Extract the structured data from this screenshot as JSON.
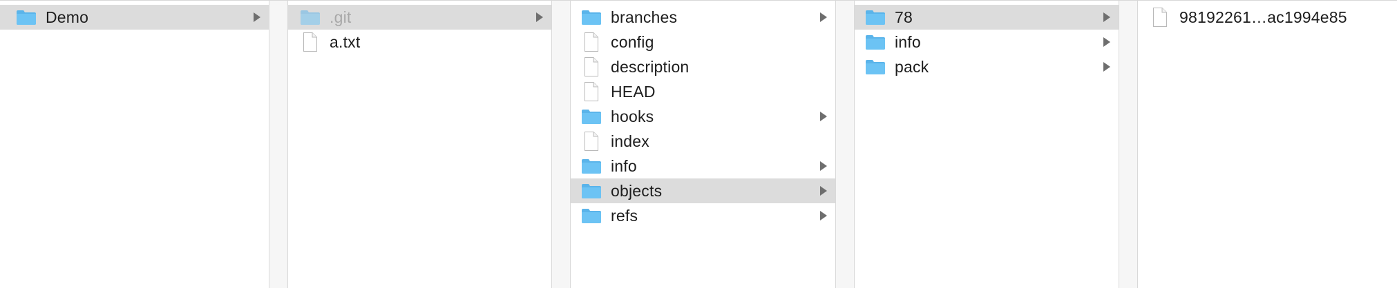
{
  "columns": [
    {
      "items": [
        {
          "label": "Demo",
          "icon": "folder-icon",
          "selected": true,
          "has_children": true
        }
      ]
    },
    {
      "items": [
        {
          "label": ".git",
          "icon": "folder-icon",
          "selected": true,
          "dimmed": true,
          "has_children": true
        },
        {
          "label": "a.txt",
          "icon": "document-icon",
          "has_children": false
        }
      ]
    },
    {
      "items": [
        {
          "label": "branches",
          "icon": "folder-icon",
          "has_children": true
        },
        {
          "label": "config",
          "icon": "document-icon",
          "has_children": false
        },
        {
          "label": "description",
          "icon": "document-icon",
          "has_children": false
        },
        {
          "label": "HEAD",
          "icon": "document-icon",
          "has_children": false
        },
        {
          "label": "hooks",
          "icon": "folder-icon",
          "has_children": true
        },
        {
          "label": "index",
          "icon": "document-icon",
          "has_children": false
        },
        {
          "label": "info",
          "icon": "folder-icon",
          "has_children": true
        },
        {
          "label": "objects",
          "icon": "folder-icon",
          "selected": true,
          "has_children": true
        },
        {
          "label": "refs",
          "icon": "folder-icon",
          "has_children": true
        }
      ]
    },
    {
      "items": [
        {
          "label": "78",
          "icon": "folder-icon",
          "selected": true,
          "has_children": true
        },
        {
          "label": "info",
          "icon": "folder-icon",
          "has_children": true
        },
        {
          "label": "pack",
          "icon": "folder-icon",
          "has_children": true
        }
      ]
    },
    {
      "items": [
        {
          "label": "98192261…ac1994e85",
          "icon": "document-icon",
          "has_children": false
        }
      ]
    }
  ],
  "colors": {
    "folder_fill": "#6cc3f4",
    "folder_tab": "#5ab4ea",
    "selection": "#dcdcdc",
    "chevron": "#6e6e6e"
  }
}
